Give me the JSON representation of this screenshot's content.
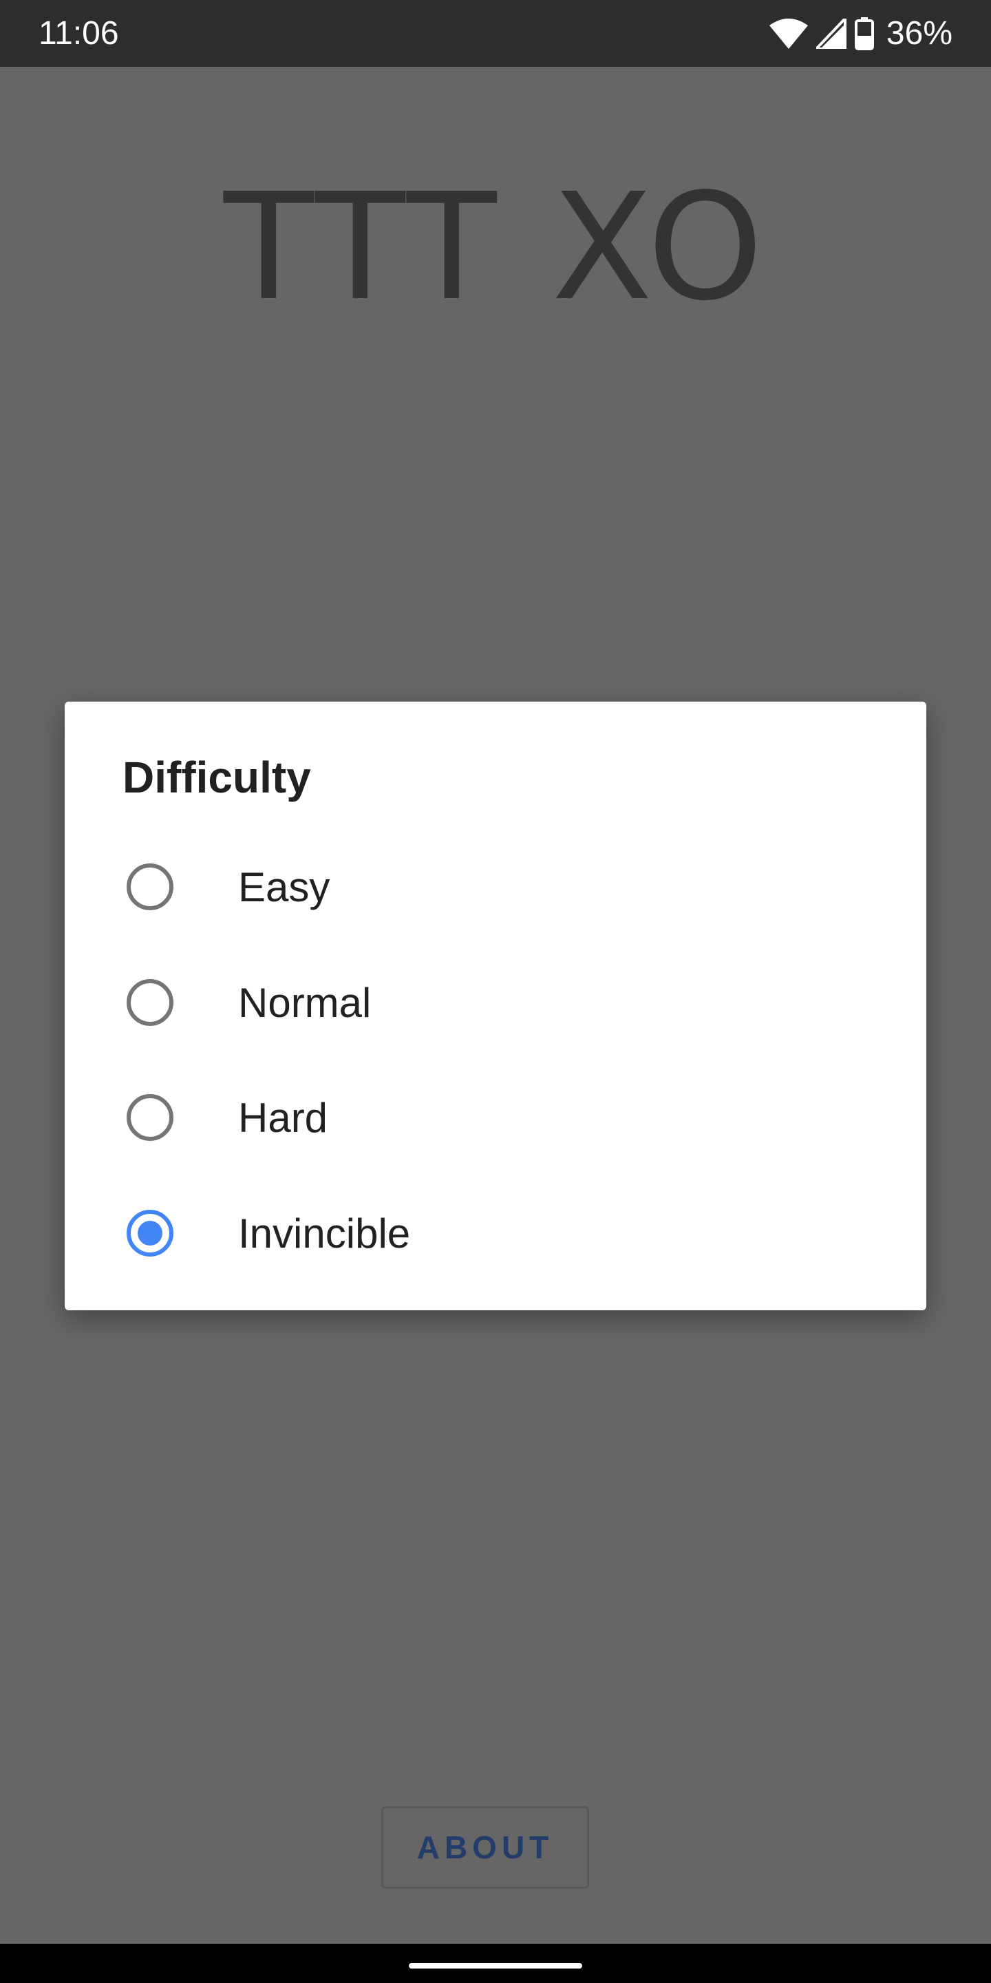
{
  "status_bar": {
    "time": "11:06",
    "battery_percent": "36%",
    "icons": [
      "wifi-icon",
      "cell-signal-icon",
      "battery-icon"
    ]
  },
  "app": {
    "title": "TTT XO",
    "about_label": "ABOUT"
  },
  "dialog": {
    "title": "Difficulty",
    "options": [
      {
        "label": "Easy",
        "selected": false
      },
      {
        "label": "Normal",
        "selected": false
      },
      {
        "label": "Hard",
        "selected": false
      },
      {
        "label": "Invincible",
        "selected": true
      }
    ]
  },
  "colors": {
    "accent": "#4285f4",
    "scrim_background": "#666666",
    "status_bar": "#2d2d2d",
    "dialog_background": "#ffffff"
  }
}
